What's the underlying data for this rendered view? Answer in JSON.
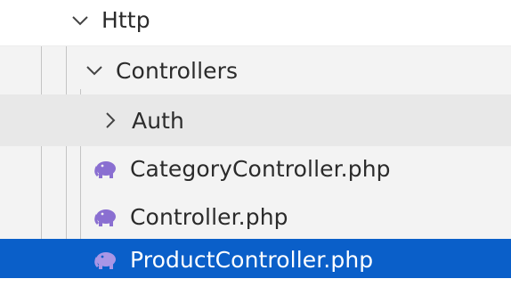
{
  "explorer": {
    "folders": {
      "http": "Http",
      "controllers": "Controllers",
      "auth": "Auth"
    },
    "files": [
      "CategoryController.php",
      "Controller.php",
      "ProductController.php"
    ],
    "icons": {
      "expanded": "chevron-down-icon",
      "collapsed": "chevron-right-icon",
      "php": "php-elephant-icon"
    },
    "colors": {
      "selection": "#0a5fc9",
      "hover": "#e8e8e8",
      "php_icon": "#8a6fd1"
    }
  }
}
